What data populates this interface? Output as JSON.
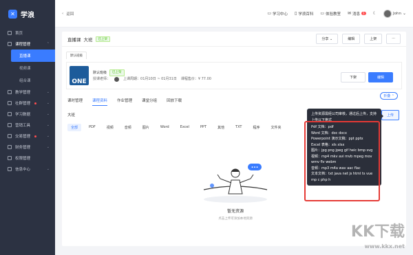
{
  "brand": {
    "name": "学浪",
    "mark": "✕"
  },
  "sidebar": {
    "items": [
      {
        "label": "首页"
      },
      {
        "label": "课程管理"
      },
      {
        "label": "直播课"
      },
      {
        "label": "视频课"
      },
      {
        "label": "组合课"
      },
      {
        "label": "教学管理"
      },
      {
        "label": "社群管理"
      },
      {
        "label": "学习数据"
      },
      {
        "label": "营销工具"
      },
      {
        "label": "交易管理"
      },
      {
        "label": "财务管理"
      },
      {
        "label": "权限管理"
      },
      {
        "label": "信息中心"
      }
    ]
  },
  "topbar": {
    "back": "返回",
    "links": [
      "学习中心",
      "学浪百科",
      "体验教室",
      "消息"
    ],
    "msg_badge": "1",
    "user": "John"
  },
  "course": {
    "type": "直播课",
    "name": "大班",
    "status": "已上架"
  },
  "actions": {
    "share": "分享",
    "edit": "编辑",
    "publish": "上架",
    "more": "···"
  },
  "period_tab": "默认班级",
  "class_info": {
    "name": "默认班级",
    "status": "已上架",
    "teacher_label": "授课老师：",
    "period": "上课周期：01月10日 ~ 01月31日",
    "price": "课程售价：¥ 77.00",
    "thumb": "ONE",
    "offline": "下架",
    "edit": "编辑"
  },
  "fold": "折叠",
  "tabs": [
    "课时管理",
    "课程资料",
    "作业管理",
    "课堂分组",
    "回放下载"
  ],
  "section_title": "大班",
  "upload": "上传",
  "filters": [
    "全部",
    "PDF",
    "视频",
    "音频",
    "图片",
    "Word",
    "Excel",
    "PPT",
    "其他",
    "TXT",
    "程序",
    "文件夹"
  ],
  "tooltip": {
    "head": "上传资源需经公司审核，通过后上传，支持上传以下格式",
    "lines": [
      "Pdf 文档：pdf",
      "Word 文档：doc docx",
      "Powerpoint 演示文稿：ppt pptx",
      "Excel 表格：xls xlsx",
      "图片：jpg png jpeg gif heic bmp svg",
      "视频：mp4 mkv avi mvb mpeg mov wmv flv webm",
      "音频：mp3 m4a wav aac flac",
      "文本文档：txt java net js html ts vue mp c php h"
    ]
  },
  "empty": {
    "title": "暂无资源",
    "subtitle": "点击上传可添加本地资源",
    "bubble": "•••"
  },
  "watermark": {
    "logo": "KK下载",
    "url": "www.kkx.net"
  }
}
